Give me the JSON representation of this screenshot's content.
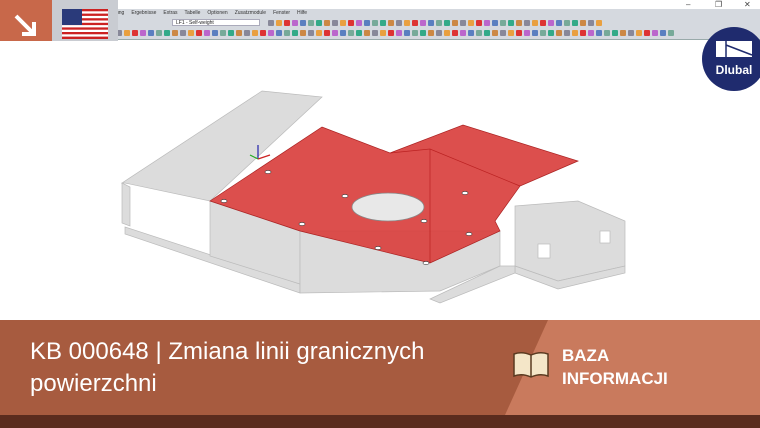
{
  "window": {
    "minimize": "–",
    "restore": "❐",
    "close": "✕"
  },
  "menu": [
    "ung",
    "Ergebnisse",
    "Extras",
    "Tabelle",
    "Optionen",
    "Zusatzmodule",
    "Fenster",
    "Hilfe"
  ],
  "toolbar": {
    "load_case": "LF1 - Self-weight"
  },
  "logo": {
    "text": "Dlubal"
  },
  "banner": {
    "title": "KB 000648 | Zmiana linii granicznych powierzchni",
    "section_line1": "BAZA",
    "section_line2": "INFORMACJI"
  },
  "colors": {
    "accent": "#c8684a",
    "banner": "#a75b3f",
    "surface": "#d93a3a",
    "logo": "#1f2b6e"
  }
}
